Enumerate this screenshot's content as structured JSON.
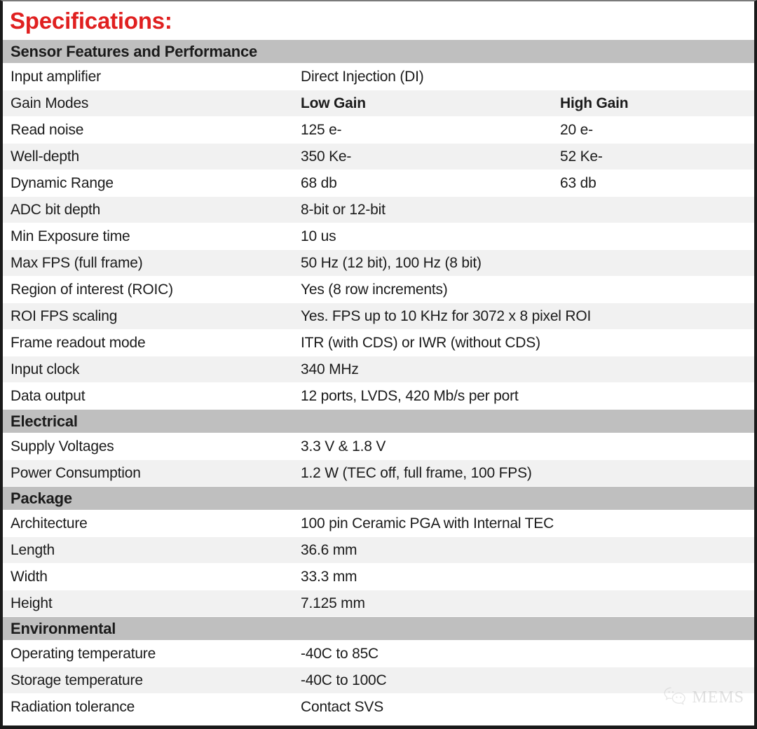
{
  "title": "Specifications:",
  "title_color": "#E02020",
  "section_header_bg": "#BFBFBF",
  "row_alt_bg": "#F1F1F1",
  "watermark": {
    "icon": "wechat-icon",
    "label": "MEMS"
  },
  "sections": [
    {
      "name": "Sensor Features and Performance",
      "rows": [
        {
          "label": "Input amplifier",
          "v1": "Direct Injection (DI)",
          "v2": "",
          "bold": false,
          "wide": true
        },
        {
          "label": "Gain Modes",
          "v1": "Low Gain",
          "v2": "High Gain",
          "bold": true,
          "wide": false
        },
        {
          "label": "Read noise",
          "v1": "125 e-",
          "v2": "20 e-",
          "bold": false,
          "wide": false
        },
        {
          "label": "Well-depth",
          "v1": "350 Ke-",
          "v2": "52 Ke-",
          "bold": false,
          "wide": false
        },
        {
          "label": "Dynamic Range",
          "v1": "68 db",
          "v2": "63 db",
          "bold": false,
          "wide": false
        },
        {
          "label": "ADC bit depth",
          "v1": "8-bit or 12-bit",
          "v2": "",
          "bold": false,
          "wide": true
        },
        {
          "label": "Min Exposure time",
          "v1": "10 us",
          "v2": "",
          "bold": false,
          "wide": true
        },
        {
          "label": "Max FPS (full frame)",
          "v1": "50 Hz (12 bit), 100 Hz (8 bit)",
          "v2": "",
          "bold": false,
          "wide": true
        },
        {
          "label": "Region of interest (ROIC)",
          "v1": "Yes (8 row increments)",
          "v2": "",
          "bold": false,
          "wide": true
        },
        {
          "label": "ROI FPS scaling",
          "v1": "Yes. FPS up to 10 KHz for 3072 x 8 pixel ROI",
          "v2": "",
          "bold": false,
          "wide": true
        },
        {
          "label": "Frame readout mode",
          "v1": "ITR (with CDS) or IWR (without CDS)",
          "v2": "",
          "bold": false,
          "wide": true
        },
        {
          "label": "Input clock",
          "v1": "340 MHz",
          "v2": "",
          "bold": false,
          "wide": true
        },
        {
          "label": "Data output",
          "v1": "12 ports, LVDS, 420 Mb/s per port",
          "v2": "",
          "bold": false,
          "wide": true
        }
      ]
    },
    {
      "name": "Electrical",
      "rows": [
        {
          "label": "Supply Voltages",
          "v1": "3.3 V & 1.8 V",
          "v2": "",
          "bold": false,
          "wide": true
        },
        {
          "label": "Power Consumption",
          "v1": "1.2 W (TEC off, full frame, 100 FPS)",
          "v2": "",
          "bold": false,
          "wide": true
        }
      ]
    },
    {
      "name": "Package",
      "rows": [
        {
          "label": "Architecture",
          "v1": "100 pin Ceramic PGA with Internal TEC",
          "v2": "",
          "bold": false,
          "wide": true
        },
        {
          "label": "Length",
          "v1": "36.6 mm",
          "v2": "",
          "bold": false,
          "wide": true
        },
        {
          "label": "Width",
          "v1": "33.3 mm",
          "v2": "",
          "bold": false,
          "wide": true
        },
        {
          "label": "Height",
          "v1": "7.125 mm",
          "v2": "",
          "bold": false,
          "wide": true
        }
      ]
    },
    {
      "name": "Environmental",
      "rows": [
        {
          "label": "Operating temperature",
          "v1": "-40C to 85C",
          "v2": "",
          "bold": false,
          "wide": true
        },
        {
          "label": "Storage temperature",
          "v1": "-40C to 100C",
          "v2": "",
          "bold": false,
          "wide": true
        },
        {
          "label": "Radiation tolerance",
          "v1": "Contact SVS",
          "v2": "",
          "bold": false,
          "wide": true
        }
      ]
    }
  ]
}
